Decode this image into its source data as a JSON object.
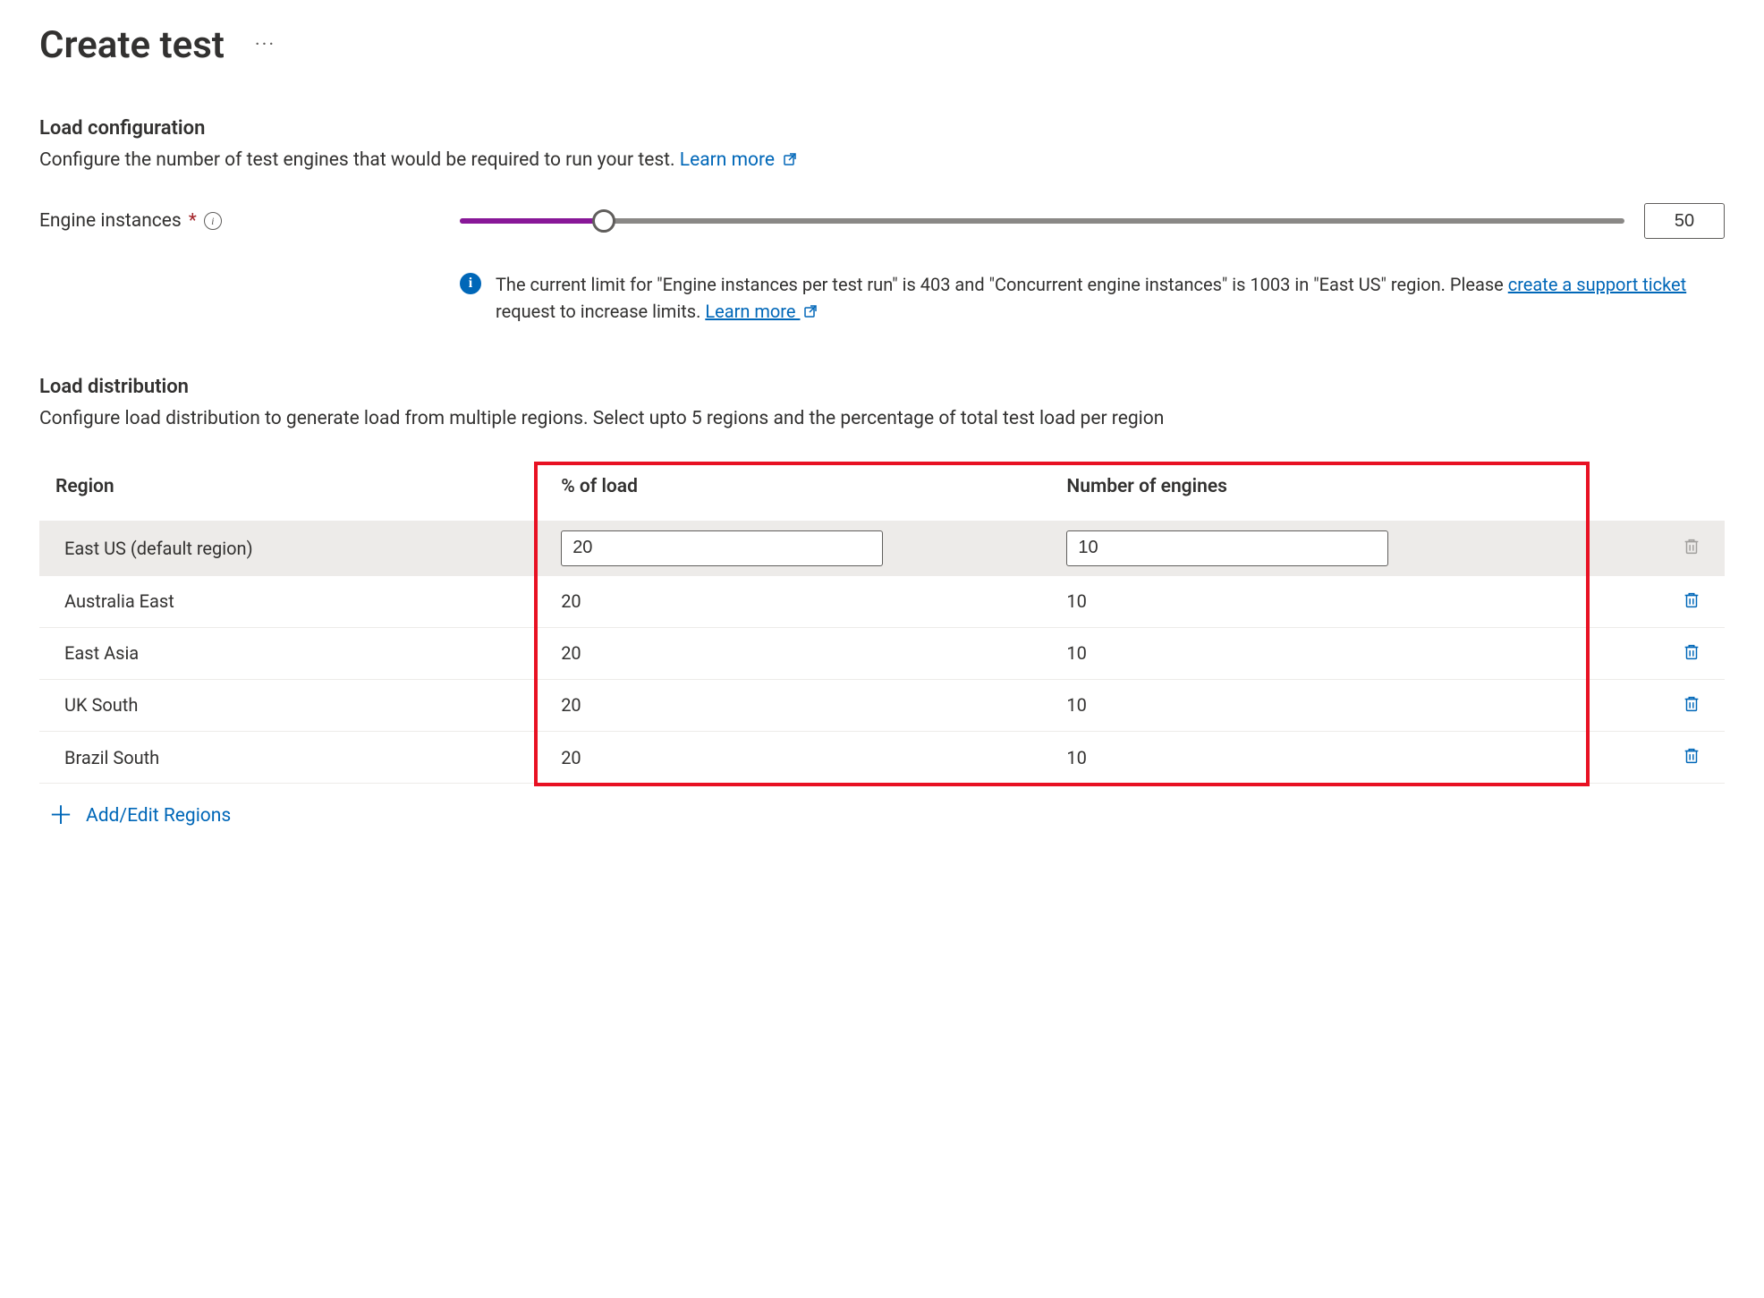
{
  "title": "Create test",
  "load_config": {
    "heading": "Load configuration",
    "description": "Configure the number of test engines that would be required to run your test. ",
    "learn_more": "Learn more",
    "engine_label": "Engine instances",
    "slider_value": "50",
    "slider_percent": 12.4,
    "banner_pre": "The current limit for \"Engine instances per test run\" is 403 and \"Concurrent engine instances\" is 1003 in \"East US\" region. Please ",
    "banner_link1": "create a support ticket",
    "banner_mid": " request to increase limits. ",
    "banner_link2": "Learn more"
  },
  "load_dist": {
    "heading": "Load distribution",
    "description": "Configure load distribution to generate load from multiple regions. Select upto 5 regions and the percentage of total test load per region",
    "col_region": "Region",
    "col_load": "% of load",
    "col_engines": "Number of engines",
    "rows": [
      {
        "region": "East US (default region)",
        "load": "20",
        "engines": "10",
        "default": true
      },
      {
        "region": "Australia East",
        "load": "20",
        "engines": "10",
        "default": false
      },
      {
        "region": "East Asia",
        "load": "20",
        "engines": "10",
        "default": false
      },
      {
        "region": "UK South",
        "load": "20",
        "engines": "10",
        "default": false
      },
      {
        "region": "Brazil South",
        "load": "20",
        "engines": "10",
        "default": false
      }
    ],
    "add_label": "Add/Edit Regions"
  }
}
